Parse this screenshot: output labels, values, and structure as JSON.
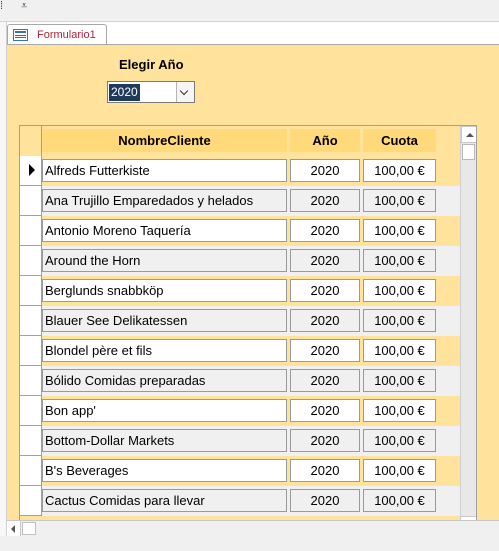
{
  "tab": {
    "label": "Formulario1"
  },
  "chooser": {
    "label": "Elegir Año",
    "value": "2020"
  },
  "table": {
    "headers": {
      "name": "NombreCliente",
      "year": "Año",
      "quota": "Cuota"
    },
    "rows": [
      {
        "name": "Alfreds Futterkiste",
        "year": "2020",
        "quota": "100,00 €"
      },
      {
        "name": "Ana Trujillo Emparedados y helados",
        "year": "2020",
        "quota": "100,00 €"
      },
      {
        "name": "Antonio Moreno Taquería",
        "year": "2020",
        "quota": "100,00 €"
      },
      {
        "name": "Around the Horn",
        "year": "2020",
        "quota": "100,00 €"
      },
      {
        "name": "Berglunds snabbköp",
        "year": "2020",
        "quota": "100,00 €"
      },
      {
        "name": "Blauer See Delikatessen",
        "year": "2020",
        "quota": "100,00 €"
      },
      {
        "name": "Blondel père et fils",
        "year": "2020",
        "quota": "100,00 €"
      },
      {
        "name": "Bólido Comidas preparadas",
        "year": "2020",
        "quota": "100,00 €"
      },
      {
        "name": "Bon app'",
        "year": "2020",
        "quota": "100,00 €"
      },
      {
        "name": "Bottom-Dollar Markets",
        "year": "2020",
        "quota": "100,00 €"
      },
      {
        "name": "B's Beverages",
        "year": "2020",
        "quota": "100,00 €"
      },
      {
        "name": "Cactus Comidas para llevar",
        "year": "2020",
        "quota": "100,00 €"
      }
    ]
  },
  "colors": {
    "form_background": "#ffe39c",
    "header_background": "#ffd97a",
    "alt_row": "#f0f0f0",
    "tab_text": "#b0243a",
    "selected_text_bg": "#1f3b5a"
  }
}
